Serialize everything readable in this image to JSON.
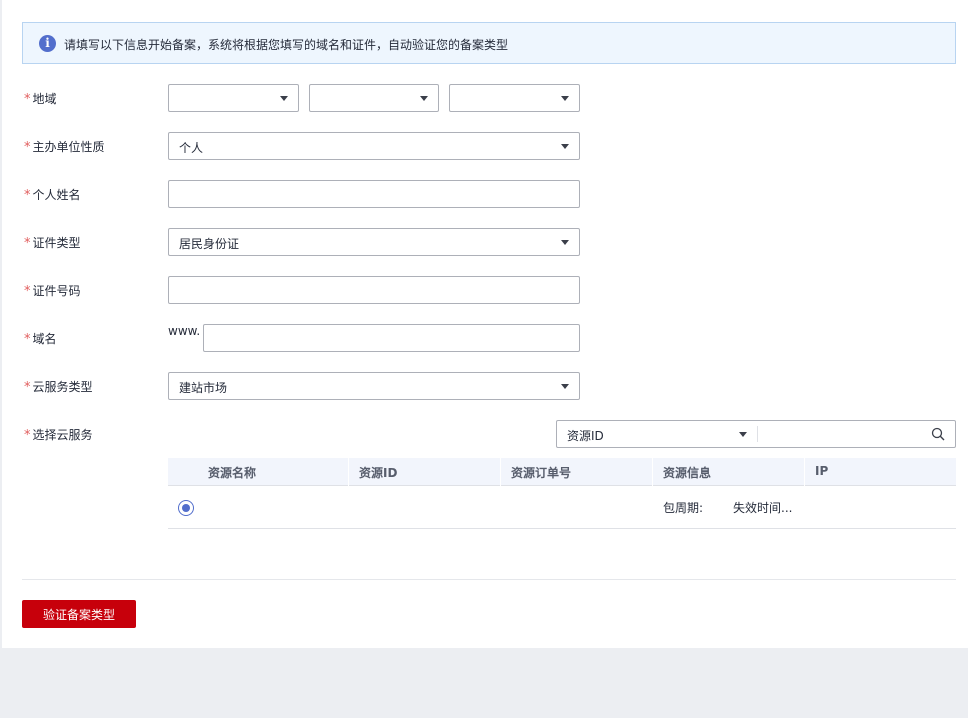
{
  "notice": {
    "text": "请填写以下信息开始备案，系统将根据您填写的域名和证件，自动验证您的备案类型"
  },
  "form": {
    "region": {
      "label": "地域",
      "province": "",
      "city": "",
      "district": ""
    },
    "organizer_type": {
      "label": "主办单位性质",
      "value": "个人"
    },
    "personal_name": {
      "label": "个人姓名",
      "value": ""
    },
    "id_type": {
      "label": "证件类型",
      "value": "居民身份证"
    },
    "id_number": {
      "label": "证件号码",
      "value": ""
    },
    "domain": {
      "label": "域名",
      "prefix": "www.",
      "value": ""
    },
    "cloud_service_type": {
      "label": "云服务类型",
      "value": "建站市场"
    },
    "select_cloud_service": {
      "label": "选择云服务"
    },
    "required_mark": "*"
  },
  "resource_filter": {
    "field": "资源ID",
    "query": ""
  },
  "table": {
    "columns": [
      "资源名称",
      "资源ID",
      "资源订单号",
      "资源信息",
      "IP"
    ],
    "rows": [
      {
        "selected": true,
        "name": "",
        "id": "",
        "order": "",
        "info_type": "包周期:",
        "info_expire": "失效时间...",
        "ip": ""
      }
    ]
  },
  "actions": {
    "verify_label": "验证备案类型"
  },
  "colors": {
    "brand_red": "#c7000b",
    "info_blue": "#526ecc",
    "required_star": "#e15c5c"
  }
}
